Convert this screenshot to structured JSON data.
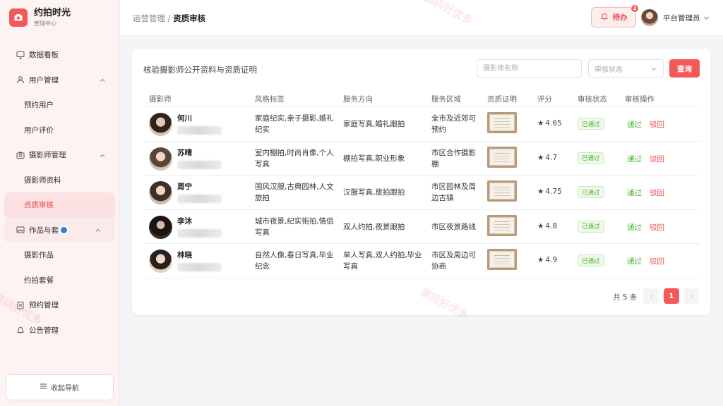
{
  "brand": {
    "title": "约拍时光",
    "subtitle": "管理中心"
  },
  "sidebar": {
    "items": [
      {
        "label": "数据看板",
        "icon": "dashboard-icon"
      },
      {
        "label": "用户管理",
        "icon": "user-icon"
      },
      {
        "label": "预约用户"
      },
      {
        "label": "用户评价"
      },
      {
        "label": "摄影师管理",
        "icon": "camera-icon"
      },
      {
        "label": "摄影师资料"
      },
      {
        "label": "资质审核"
      },
      {
        "label": "作品与套",
        "icon": "image-icon"
      },
      {
        "label": "摄影作品"
      },
      {
        "label": "约拍套餐"
      },
      {
        "label": "预约管理",
        "icon": "calendar-icon"
      },
      {
        "label": "公告管理",
        "icon": "bell-icon"
      }
    ],
    "collapse_label": "收起导航"
  },
  "header": {
    "breadcrumb_parent": "运营管理",
    "breadcrumb_separator": "/",
    "breadcrumb_current": "资质审核",
    "todo_label": "待办",
    "todo_count": "2",
    "user_name": "平台管理员"
  },
  "card": {
    "title": "核验摄影师公开资料与资质证明",
    "search_placeholder": "摄影师名称",
    "status_placeholder": "审核状态",
    "query_label": "查询"
  },
  "table": {
    "columns": [
      "摄影师",
      "风格标签",
      "服务方向",
      "服务区域",
      "资质证明",
      "评分",
      "审核状态",
      "审核操作"
    ],
    "rows": [
      {
        "name": "何川",
        "style": "家庭纪实,亲子摄影,婚礼纪实",
        "direction": "家庭写真,婚礼跟拍",
        "area": "全市及近郊可预约",
        "rating": "4.65",
        "status": "已通过",
        "pass": "通过",
        "reject": "驳回"
      },
      {
        "name": "苏晴",
        "style": "室内棚拍,时尚肖像,个人写真",
        "direction": "棚拍写真,职业形象",
        "area": "市区合作摄影棚",
        "rating": "4.7",
        "status": "已通过",
        "pass": "通过",
        "reject": "驳回"
      },
      {
        "name": "周宁",
        "style": "国风汉服,古典园林,人文旅拍",
        "direction": "汉服写真,旅拍跟拍",
        "area": "市区园林及周边古镇",
        "rating": "4.75",
        "status": "已通过",
        "pass": "通过",
        "reject": "驳回"
      },
      {
        "name": "李沐",
        "style": "城市夜景,纪实街拍,情侣写真",
        "direction": "双人约拍,夜景跟拍",
        "area": "市区夜景路线",
        "rating": "4.8",
        "status": "已通过",
        "pass": "通过",
        "reject": "驳回"
      },
      {
        "name": "林晓",
        "style": "自然人像,春日写真,毕业纪念",
        "direction": "单人写真,双人约拍,毕业写真",
        "area": "市区及周边可协商",
        "rating": "4.9",
        "status": "已通过",
        "pass": "通过",
        "reject": "驳回"
      }
    ]
  },
  "pagination": {
    "total_text": "共 5 条",
    "current_page": "1",
    "prev": "‹",
    "next": "›"
  },
  "watermarks": [
    "源码好优多",
    "源码好优多",
    "源码好优多"
  ],
  "colors": {
    "accent": "#f25a5a",
    "success": "#52b13c",
    "sidebar_bg": "#fdf3f3"
  }
}
